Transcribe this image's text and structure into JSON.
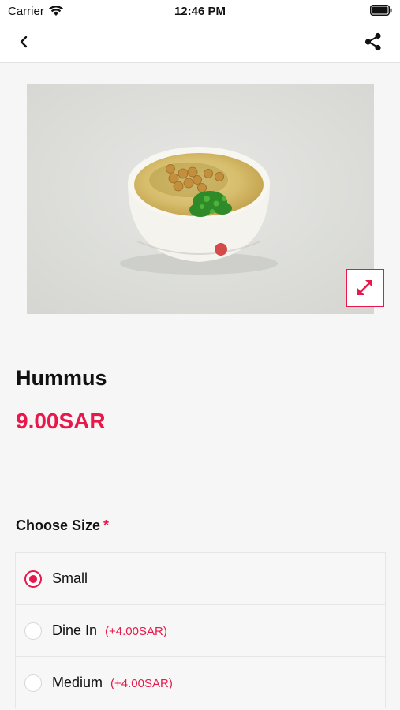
{
  "status_bar": {
    "carrier": "Carrier",
    "time": "12:46 PM"
  },
  "nav": {
    "back_icon": "chevron-left-icon",
    "share_icon": "share-icon"
  },
  "product": {
    "name": "Hummus",
    "price": "9.00SAR",
    "image_icon": "expand-icon"
  },
  "size_section": {
    "title": "Choose Size",
    "required_mark": "*",
    "options": [
      {
        "label": "Small",
        "extra": "",
        "selected": true
      },
      {
        "label": "Dine In",
        "extra": "(+4.00SAR)",
        "selected": false
      },
      {
        "label": "Medium",
        "extra": "(+4.00SAR)",
        "selected": false
      }
    ]
  },
  "colors": {
    "accent": "#e8194a",
    "background": "#f6f6f6"
  }
}
